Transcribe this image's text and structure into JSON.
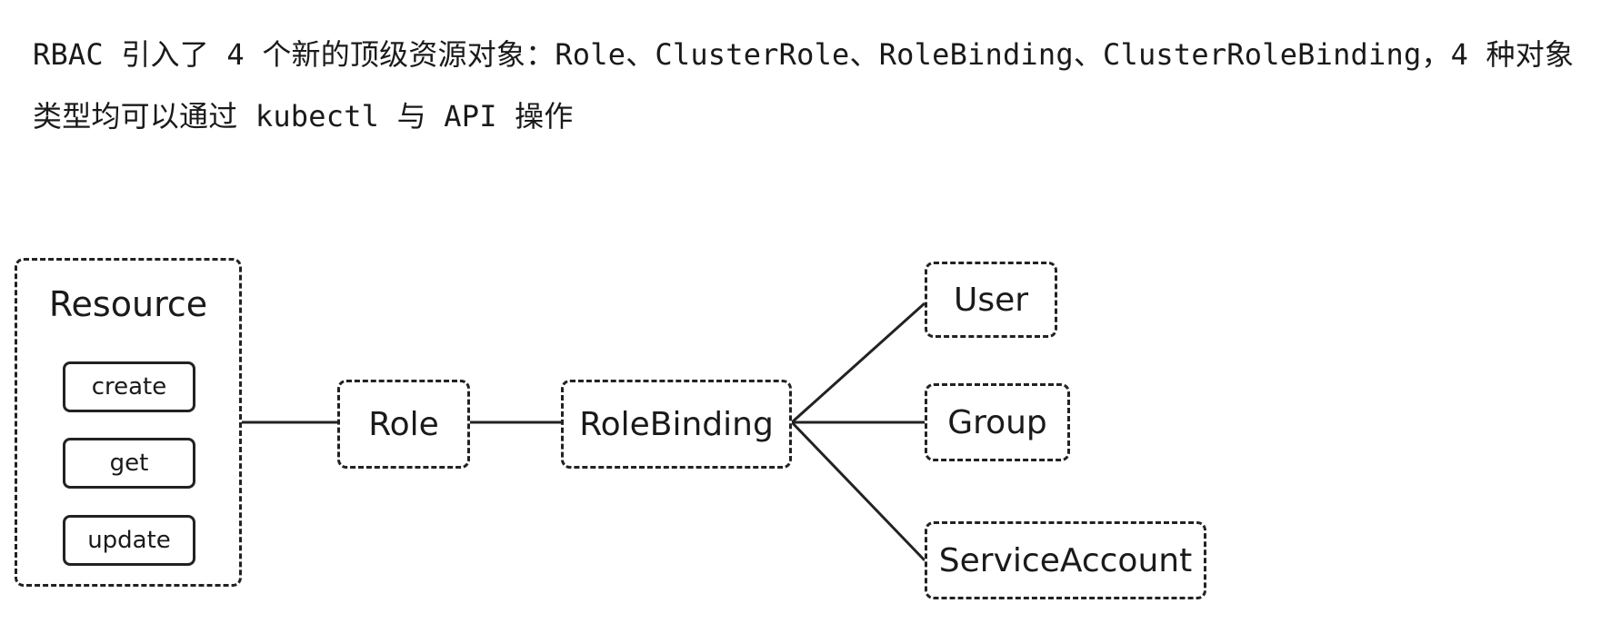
{
  "text": {
    "intro": "RBAC 引入了 4 个新的顶级资源对象：Role、ClusterRole、RoleBinding、ClusterRoleBinding，4 种对象类型均可以通过 kubectl 与 API 操作"
  },
  "diagram": {
    "resource": {
      "title": "Resource",
      "actions": [
        "create",
        "get",
        "update"
      ]
    },
    "role": "Role",
    "rolebinding": "RoleBinding",
    "subjects": {
      "user": "User",
      "group": "Group",
      "serviceaccount": "ServiceAccount"
    }
  },
  "colors": {
    "stroke": "#222222",
    "text": "#1a1a1a",
    "background": "#ffffff"
  }
}
